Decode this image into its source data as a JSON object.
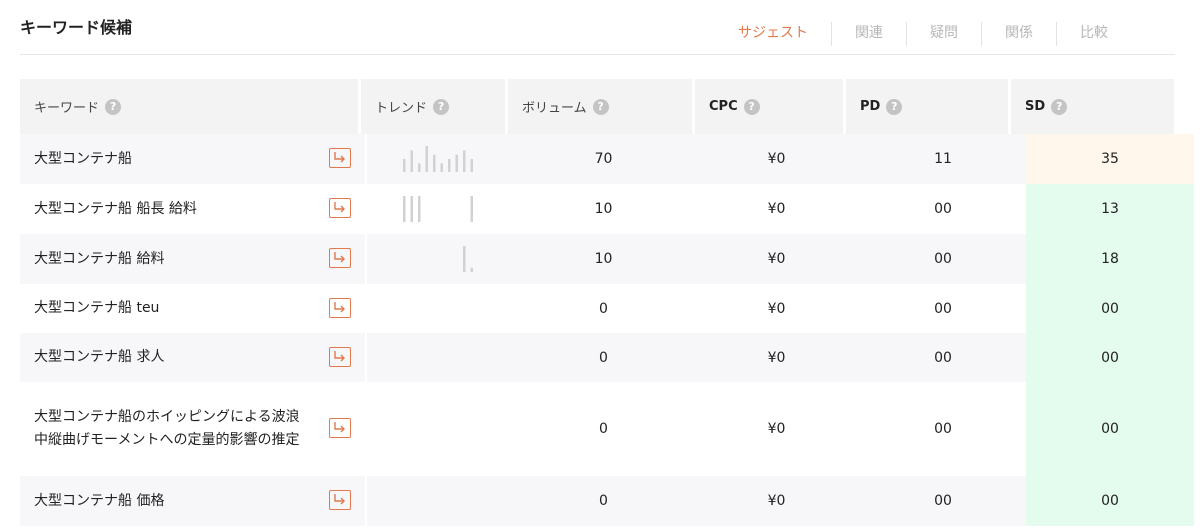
{
  "panel": {
    "title": "キーワード候補"
  },
  "tabs": [
    {
      "label": "サジェスト",
      "active": true
    },
    {
      "label": "関連",
      "active": false
    },
    {
      "label": "疑問",
      "active": false
    },
    {
      "label": "関係",
      "active": false
    },
    {
      "label": "比較",
      "active": false
    }
  ],
  "columns": [
    "キーワード",
    "トレンド",
    "ボリューム",
    "CPC",
    "PD",
    "SD"
  ],
  "rows": [
    {
      "keyword": "大型コンテナ船",
      "volume": "70",
      "cpc": "¥0",
      "pd": "11",
      "sd": "35",
      "sd_color": "#fff7eb",
      "trend": [
        3,
        5,
        2,
        6,
        4,
        2,
        3,
        4,
        5,
        3
      ]
    },
    {
      "keyword": "大型コンテナ船 船長 給料",
      "volume": "10",
      "cpc": "¥0",
      "pd": "00",
      "sd": "13",
      "sd_color": "#e4fcee",
      "trend": [
        6,
        6,
        6,
        0,
        0,
        0,
        0,
        0,
        0,
        6
      ]
    },
    {
      "keyword": "大型コンテナ船 給料",
      "volume": "10",
      "cpc": "¥0",
      "pd": "00",
      "sd": "18",
      "sd_color": "#e4fcee",
      "trend": [
        0,
        0,
        0,
        0,
        0,
        0,
        0,
        0,
        6,
        1
      ]
    },
    {
      "keyword": "大型コンテナ船 teu",
      "volume": "0",
      "cpc": "¥0",
      "pd": "00",
      "sd": "00",
      "sd_color": "#e4fcee",
      "trend": []
    },
    {
      "keyword": "大型コンテナ船 求人",
      "volume": "0",
      "cpc": "¥0",
      "pd": "00",
      "sd": "00",
      "sd_color": "#e4fcee",
      "trend": []
    },
    {
      "keyword": "大型コンテナ船のホイッピングによる波浪中縦曲げモーメントへの定量的影響の推定",
      "volume": "0",
      "cpc": "¥0",
      "pd": "00",
      "sd": "00",
      "sd_color": "#e4fcee",
      "trend": []
    },
    {
      "keyword": "大型コンテナ船 価格",
      "volume": "0",
      "cpc": "¥0",
      "pd": "00",
      "sd": "00",
      "sd_color": "#e4fcee",
      "trend": []
    }
  ],
  "colors": {
    "accent": "#e07a4d",
    "row_alt": "#f7f7f9",
    "header_bg": "#f3f3f4",
    "trend_bar": "#d2d2d2"
  }
}
